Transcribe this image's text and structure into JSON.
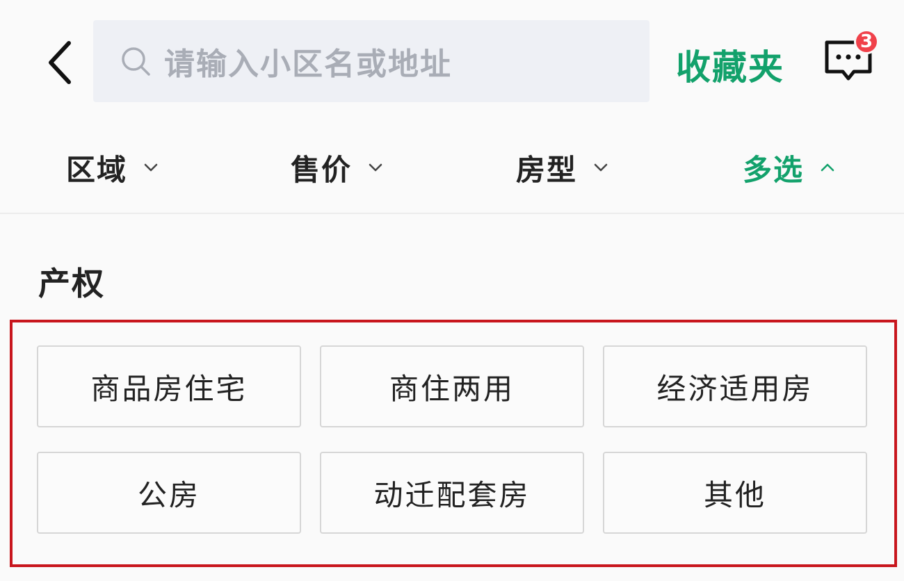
{
  "header": {
    "search_placeholder": "请输入小区名或地址",
    "favorites_label": "收藏夹",
    "message_badge_count": "3"
  },
  "filters": [
    {
      "label": "区域",
      "active": false
    },
    {
      "label": "售价",
      "active": false
    },
    {
      "label": "房型",
      "active": false
    },
    {
      "label": "多选",
      "active": true
    }
  ],
  "section": {
    "title": "产权",
    "options": [
      "商品房住宅",
      "商住两用",
      "经济适用房",
      "公房",
      "动迁配套房",
      "其他"
    ]
  },
  "colors": {
    "accent": "#12a16b",
    "badge": "#f0414a",
    "highlight_border": "#c8161d",
    "search_bg": "#eef0f5"
  },
  "icons": {
    "back": "back-arrow-icon",
    "search": "search-icon",
    "message": "message-icon",
    "chevron_down": "chevron-down-icon",
    "chevron_up": "chevron-up-icon"
  }
}
